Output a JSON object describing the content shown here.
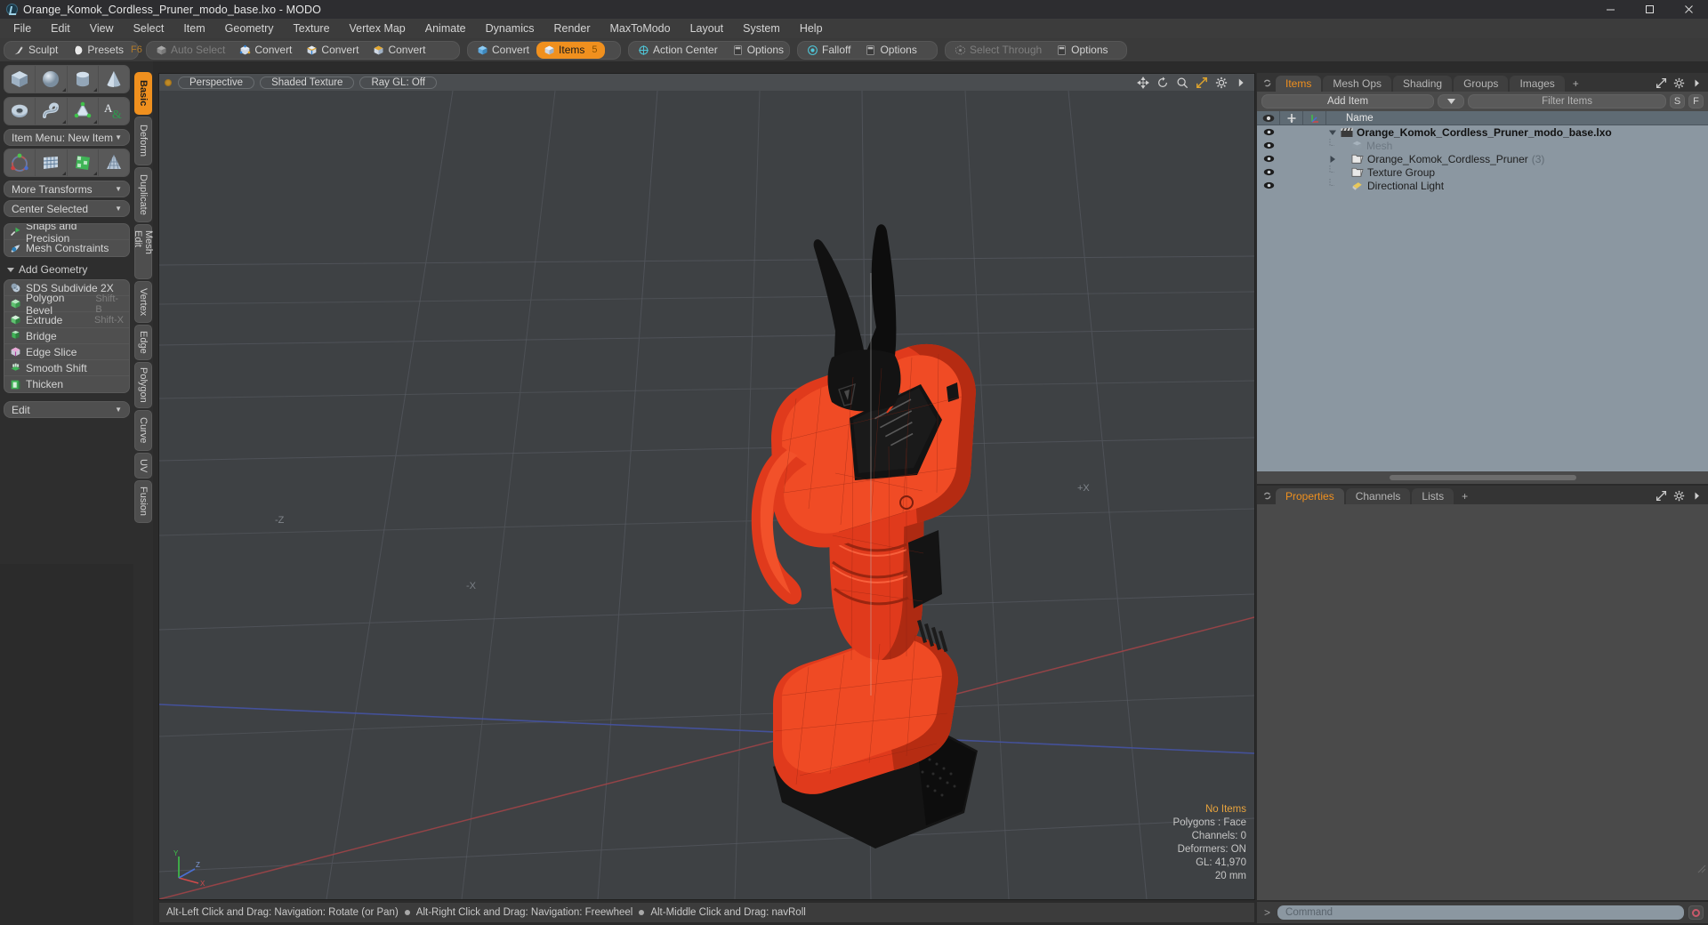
{
  "window": {
    "title": "Orange_Komok_Cordless_Pruner_modo_base.lxo - MODO",
    "app_icon": "modo-logo-icon",
    "minimize": "minimize-icon",
    "maximize": "maximize-icon",
    "close": "close-icon"
  },
  "menubar": {
    "items": [
      {
        "label": "File"
      },
      {
        "label": "Edit"
      },
      {
        "label": "View"
      },
      {
        "label": "Select"
      },
      {
        "label": "Item"
      },
      {
        "label": "Geometry"
      },
      {
        "label": "Texture"
      },
      {
        "label": "Vertex Map"
      },
      {
        "label": "Animate"
      },
      {
        "label": "Dynamics"
      },
      {
        "label": "Render"
      },
      {
        "label": "MaxToModo"
      },
      {
        "label": "Layout"
      },
      {
        "label": "System"
      },
      {
        "label": "Help"
      }
    ]
  },
  "toolbar": {
    "group1": [
      {
        "label": "Sculpt",
        "icon": "sculpt-brush-icon",
        "state": "normal",
        "shortcut": ""
      },
      {
        "label": "Presets",
        "icon": "presets-sphere-icon",
        "state": "normal",
        "shortcut": "F6"
      }
    ],
    "group2": [
      {
        "label": "Auto Select",
        "icon": "cube-grey-icon",
        "state": "dim",
        "shortcut": ""
      },
      {
        "label": "Convert",
        "icon": "convert-vertex-icon",
        "state": "normal",
        "shortcut": ""
      },
      {
        "label": "Convert",
        "icon": "convert-edge-icon",
        "state": "normal",
        "shortcut": ""
      },
      {
        "label": "Convert",
        "icon": "convert-polygon-icon",
        "state": "normal",
        "shortcut": ""
      }
    ],
    "group3": [
      {
        "label": "Convert",
        "icon": "convert-item-icon",
        "state": "normal",
        "shortcut": ""
      },
      {
        "label": "Items",
        "icon": "items-cube-icon",
        "state": "active",
        "shortcut": "5"
      }
    ],
    "group4": [
      {
        "label": "Action Center",
        "icon": "action-center-icon",
        "state": "normal",
        "shortcut": ""
      },
      {
        "label": "Options",
        "icon": "options-panel-icon",
        "state": "normal",
        "shortcut": ""
      }
    ],
    "group5": [
      {
        "label": "Falloff",
        "icon": "falloff-radial-icon",
        "state": "normal",
        "shortcut": ""
      },
      {
        "label": "Options",
        "icon": "options-panel-icon",
        "state": "normal",
        "shortcut": ""
      }
    ],
    "group6": [
      {
        "label": "Select Through",
        "icon": "select-through-icon",
        "state": "dim",
        "shortcut": ""
      },
      {
        "label": "Options",
        "icon": "options-panel-icon",
        "state": "normal",
        "shortcut": ""
      }
    ]
  },
  "left_panel": {
    "primitives_row1": [
      {
        "name": "cube-primitive-icon"
      },
      {
        "name": "sphere-primitive-icon"
      },
      {
        "name": "cylinder-primitive-icon"
      },
      {
        "name": "cone-primitive-icon"
      }
    ],
    "primitives_row2": [
      {
        "name": "torus-primitive-icon"
      },
      {
        "name": "spiral-primitive-icon"
      },
      {
        "name": "polygon-draw-icon"
      },
      {
        "name": "text-tool-icon"
      }
    ],
    "item_menu": "Item Menu: New Item",
    "transforms_row": [
      {
        "name": "transform-gizmo-icon"
      },
      {
        "name": "bend-lattice-icon"
      },
      {
        "name": "shear-deform-icon"
      },
      {
        "name": "taper-deform-icon"
      }
    ],
    "more_transforms": "More Transforms",
    "center_selected": "Center Selected",
    "snap_rows": [
      {
        "label": "Snaps and Precision",
        "icon": "snap-magnet-icon"
      },
      {
        "label": "Mesh Constraints",
        "icon": "mesh-constraint-icon"
      }
    ],
    "add_geometry_header": "Add Geometry",
    "geometry_rows": [
      {
        "label": "SDS Subdivide 2X",
        "shortcut": "",
        "icon": "sds-subdivide-icon"
      },
      {
        "label": "Polygon Bevel",
        "shortcut": "Shift-B",
        "icon": "polygon-bevel-icon"
      },
      {
        "label": "Extrude",
        "shortcut": "Shift-X",
        "icon": "extrude-icon"
      },
      {
        "label": "Bridge",
        "shortcut": "",
        "icon": "bridge-icon"
      },
      {
        "label": "Edge Slice",
        "shortcut": "",
        "icon": "edge-slice-icon"
      },
      {
        "label": "Smooth Shift",
        "shortcut": "",
        "icon": "smooth-shift-icon"
      },
      {
        "label": "Thicken",
        "shortcut": "",
        "icon": "thicken-icon"
      }
    ],
    "edit_dropdown": "Edit"
  },
  "vertical_tabs": {
    "items": [
      {
        "label": "Basic",
        "active": true
      },
      {
        "label": "Deform",
        "active": false
      },
      {
        "label": "Duplicate",
        "active": false
      },
      {
        "label": "Mesh Edit",
        "active": false
      },
      {
        "label": "Vertex",
        "active": false
      },
      {
        "label": "Edge",
        "active": false
      },
      {
        "label": "Polygon",
        "active": false
      },
      {
        "label": "Curve",
        "active": false
      },
      {
        "label": "UV",
        "active": false
      },
      {
        "label": "Fusion",
        "active": false
      }
    ]
  },
  "viewport": {
    "view_mode": "Perspective",
    "shading_mode": "Shaded Texture",
    "raygl": "Ray GL: Off",
    "icons": [
      {
        "name": "move-viewport-icon"
      },
      {
        "name": "rotate-viewport-icon"
      },
      {
        "name": "zoom-viewport-icon"
      },
      {
        "name": "maximize-viewport-icon"
      },
      {
        "name": "gear-viewport-icon"
      },
      {
        "name": "chevron-right-icon"
      }
    ],
    "hud": {
      "selection": "No Items",
      "polygons": "Polygons : Face",
      "channels": "Channels: 0",
      "deformers": "Deformers: ON",
      "gl": "GL: 41,970",
      "scale": "20 mm"
    },
    "axis_labels": {
      "x": "X",
      "y": "Y",
      "z": "Z"
    },
    "grid_marks": [
      "-Z",
      "+X",
      "-X"
    ],
    "colors": {
      "background": "#3e4144",
      "grid": "#53565a",
      "x_axis": "#a7484c",
      "z_axis": "#4a5aa8",
      "model_body": "#e8371c",
      "model_dark": "#121212"
    }
  },
  "statusbar": {
    "hints": [
      "Alt-Left Click and Drag: Navigation: Rotate (or Pan)",
      "Alt-Right Click and Drag: Navigation: Freewheel",
      "Alt-Middle Click and Drag: navRoll"
    ]
  },
  "items_panel": {
    "tabs": [
      {
        "label": "Items",
        "active": true
      },
      {
        "label": "Mesh Ops",
        "active": false
      },
      {
        "label": "Shading",
        "active": false
      },
      {
        "label": "Groups",
        "active": false
      },
      {
        "label": "Images",
        "active": false
      },
      {
        "label": "+",
        "active": false
      }
    ],
    "panel_icons": [
      {
        "name": "expand-panel-icon"
      },
      {
        "name": "gear-icon"
      },
      {
        "name": "chevron-right-icon"
      }
    ],
    "add_item_button": "Add Item",
    "filter_placeholder": "Filter Items",
    "small_buttons": [
      {
        "label": "S"
      },
      {
        "label": "F"
      }
    ],
    "columns": [
      {
        "name": "visibility-column",
        "icon": "eye-icon"
      },
      {
        "name": "lock-column",
        "icon": "lock-icon"
      },
      {
        "name": "axis-column",
        "icon": "axis-icon"
      },
      {
        "name": "name-column",
        "label": "Name"
      }
    ],
    "rows": [
      {
        "name": "Orange_Komok_Cordless_Pruner_modo_base.lxo",
        "icon": "scene-clapper-icon",
        "indent": 0,
        "expanded": true,
        "count": "",
        "dimmed": false
      },
      {
        "name": "Mesh",
        "icon": "mesh-cube-icon",
        "indent": 1,
        "expanded": null,
        "count": "",
        "dimmed": true
      },
      {
        "name": "Orange_Komok_Cordless_Pruner",
        "icon": "group-folder-icon",
        "indent": 1,
        "expanded": false,
        "count": "(3)",
        "dimmed": false
      },
      {
        "name": "Texture Group",
        "icon": "group-folder-icon",
        "indent": 1,
        "expanded": null,
        "count": "",
        "dimmed": false
      },
      {
        "name": "Directional Light",
        "icon": "light-icon",
        "indent": 1,
        "expanded": null,
        "count": "",
        "dimmed": false
      }
    ]
  },
  "properties_panel": {
    "tabs": [
      {
        "label": "Properties",
        "active": true
      },
      {
        "label": "Channels",
        "active": false
      },
      {
        "label": "Lists",
        "active": false
      },
      {
        "label": "+",
        "active": false
      }
    ],
    "panel_icons": [
      {
        "name": "expand-panel-icon"
      },
      {
        "name": "gear-icon"
      },
      {
        "name": "chevron-right-icon"
      }
    ]
  },
  "command_bar": {
    "prompt": ">",
    "placeholder": "Command",
    "record_button": "record-macro-icon"
  }
}
